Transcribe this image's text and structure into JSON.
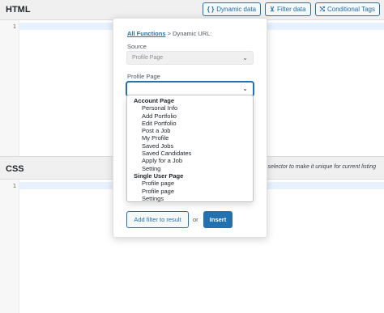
{
  "html_section": {
    "title": "HTML",
    "line_number": "1",
    "buttons": {
      "dynamic_data": {
        "icon": "{ }",
        "label": "Dynamic data"
      },
      "filter_data": {
        "icon": "⊻",
        "label": "Filter data"
      },
      "conditional_tags": {
        "icon": "⤭",
        "label": "Conditional Tags"
      }
    }
  },
  "css_section": {
    "title": "CSS",
    "line_number": "1",
    "hint": "CSS selector to make it unique for current listing"
  },
  "popup": {
    "breadcrumb_link": "All Functions",
    "breadcrumb_rest": " > Dynamic URL:",
    "source_label": "Source",
    "source_value": "Profile Page",
    "profile_page_label": "Profile Page",
    "profile_page_value": "",
    "add_filter_label": "Add filter to result",
    "or_label": "or",
    "insert_label": "Insert"
  },
  "dropdown": {
    "groups": [
      {
        "label": "Account Page",
        "options": [
          "Personal Info",
          "Add Portfolio",
          "Edit Portfolio",
          "Post a Job",
          "My Profile",
          "Saved Jobs",
          "Saved Candidates",
          "Apply for a Job",
          "Setting"
        ]
      },
      {
        "label": "Single User Page",
        "options": [
          "Profile page",
          "Profile page",
          "Settings"
        ]
      }
    ]
  },
  "colors": {
    "accent": "#2271b1",
    "background": "#f0f0f1",
    "active_line": "#e8f2ff"
  }
}
